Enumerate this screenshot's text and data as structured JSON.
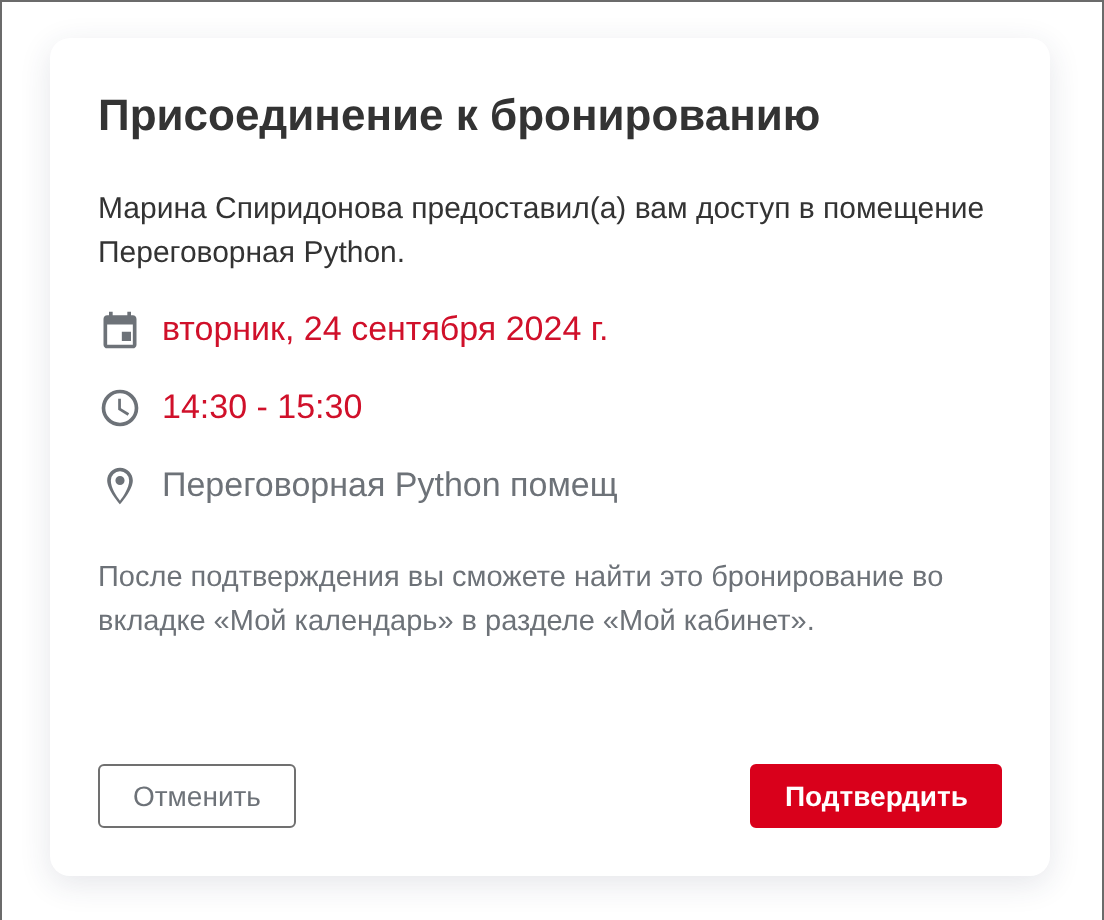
{
  "dialog": {
    "title": "Присоединение к бронированию",
    "message": "Марина Спиридонова предоставил(а) вам доступ в помещение Переговорная Python.",
    "details": [
      {
        "kind": "date",
        "text": "вторник, 24 сентября 2024 г.",
        "accent": true
      },
      {
        "kind": "time",
        "text": "14:30 - 15:30",
        "accent": true
      },
      {
        "kind": "place",
        "text": "Переговорная Python помещ",
        "accent": false
      }
    ],
    "note": "После подтверждения вы сможете найти это бронирование во вкладке «Мой календарь» в разделе «Мой кабинет».",
    "buttons": [
      {
        "kind": "secondary",
        "label": "Отменить"
      },
      {
        "kind": "primary",
        "label": "Подтвердить"
      }
    ]
  }
}
